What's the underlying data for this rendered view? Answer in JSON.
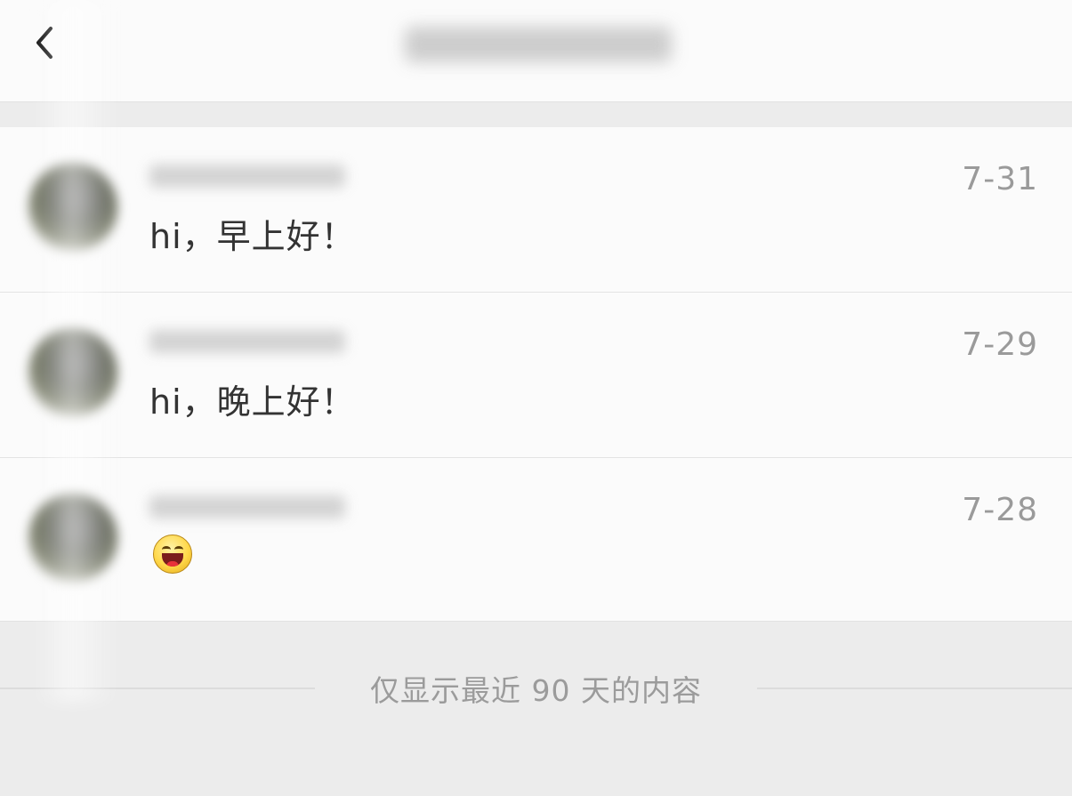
{
  "header": {
    "back_icon": "chevron-left-icon"
  },
  "messages": [
    {
      "text": "hi，早上好！",
      "date": "7-31"
    },
    {
      "text": "hi，晚上好！",
      "date": "7-29"
    },
    {
      "text": "",
      "date": "7-28",
      "emoji": "laughing-face-emoji"
    }
  ],
  "notice": {
    "text": "仅显示最近 90 天的内容"
  }
}
